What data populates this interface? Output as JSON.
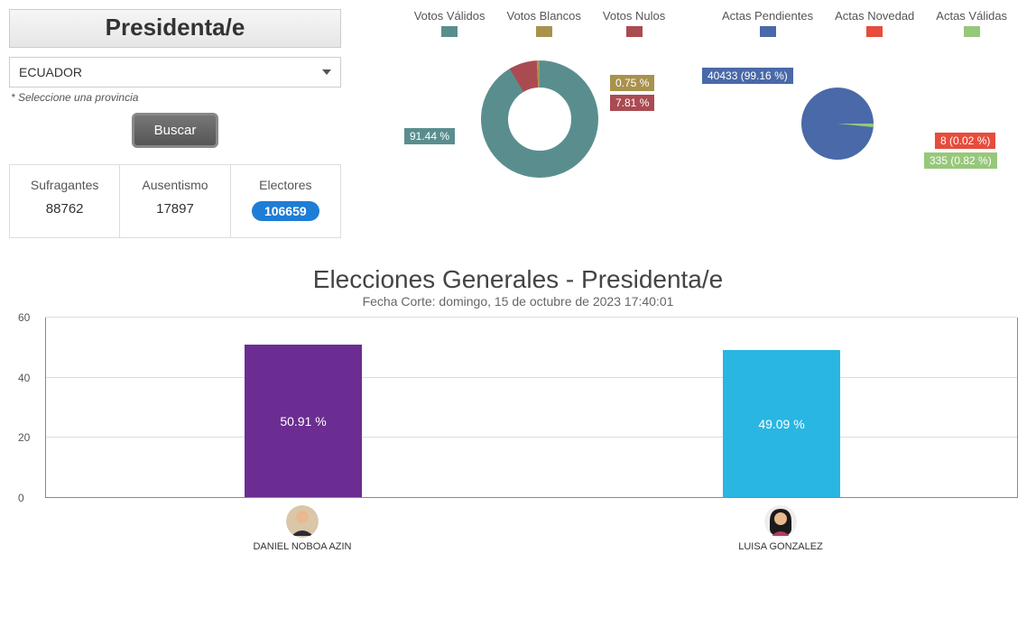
{
  "header": {
    "title": "Presidenta/e"
  },
  "filter": {
    "selected": "ECUADOR",
    "helper": "* Seleccione una provincia",
    "search_label": "Buscar"
  },
  "stats": {
    "sufragantes_label": "Sufragantes",
    "sufragantes_value": "88762",
    "ausentismo_label": "Ausentismo",
    "ausentismo_value": "17897",
    "electores_label": "Electores",
    "electores_value": "106659"
  },
  "votes_chart": {
    "legend": {
      "validos": "Votos Válidos",
      "blancos": "Votos Blancos",
      "nulos": "Votos Nulos"
    },
    "callouts": {
      "validos": "91.44 %",
      "blancos": "0.75 %",
      "nulos": "7.81 %"
    }
  },
  "actas_chart": {
    "legend": {
      "pendientes": "Actas Pendientes",
      "novedad": "Actas Novedad",
      "validas": "Actas Válidas"
    },
    "callouts": {
      "pendientes": "40433 (99.16 %)",
      "novedad": "8 (0.02 %)",
      "validas": "335 (0.82 %)"
    }
  },
  "main_chart": {
    "title": "Elecciones Generales - Presidenta/e",
    "subtitle": "Fecha Corte: domingo, 15 de octubre de 2023 17:40:01",
    "bars": {
      "noboa_label": "50.91 %",
      "gonzalez_label": "49.09 %"
    },
    "candidates": {
      "noboa": "DANIEL NOBOA AZIN",
      "gonzalez": "LUISA GONZALEZ"
    },
    "y_ticks": {
      "t0": "0",
      "t20": "20",
      "t40": "40",
      "t60": "60"
    }
  },
  "chart_data": [
    {
      "type": "pie",
      "title": "Votos",
      "series": [
        {
          "name": "Votos Válidos",
          "value": 91.44,
          "color": "#5a8e8e"
        },
        {
          "name": "Votos Blancos",
          "value": 0.75,
          "color": "#a9924d"
        },
        {
          "name": "Votos Nulos",
          "value": 7.81,
          "color": "#aa4b52"
        }
      ]
    },
    {
      "type": "pie",
      "title": "Actas",
      "series": [
        {
          "name": "Actas Pendientes",
          "value": 40433,
          "pct": 99.16,
          "color": "#4a69a8"
        },
        {
          "name": "Actas Novedad",
          "value": 8,
          "pct": 0.02,
          "color": "#e74c3c"
        },
        {
          "name": "Actas Válidas",
          "value": 335,
          "pct": 0.82,
          "color": "#97c77b"
        }
      ]
    },
    {
      "type": "bar",
      "title": "Elecciones Generales - Presidenta/e",
      "subtitle": "Fecha Corte: domingo, 15 de octubre de 2023 17:40:01",
      "ylabel": "%",
      "ylim": [
        0,
        60
      ],
      "categories": [
        "DANIEL NOBOA AZIN",
        "LUISA GONZALEZ"
      ],
      "values": [
        50.91,
        49.09
      ],
      "colors": [
        "#6b2d91",
        "#29b6e3"
      ]
    }
  ]
}
